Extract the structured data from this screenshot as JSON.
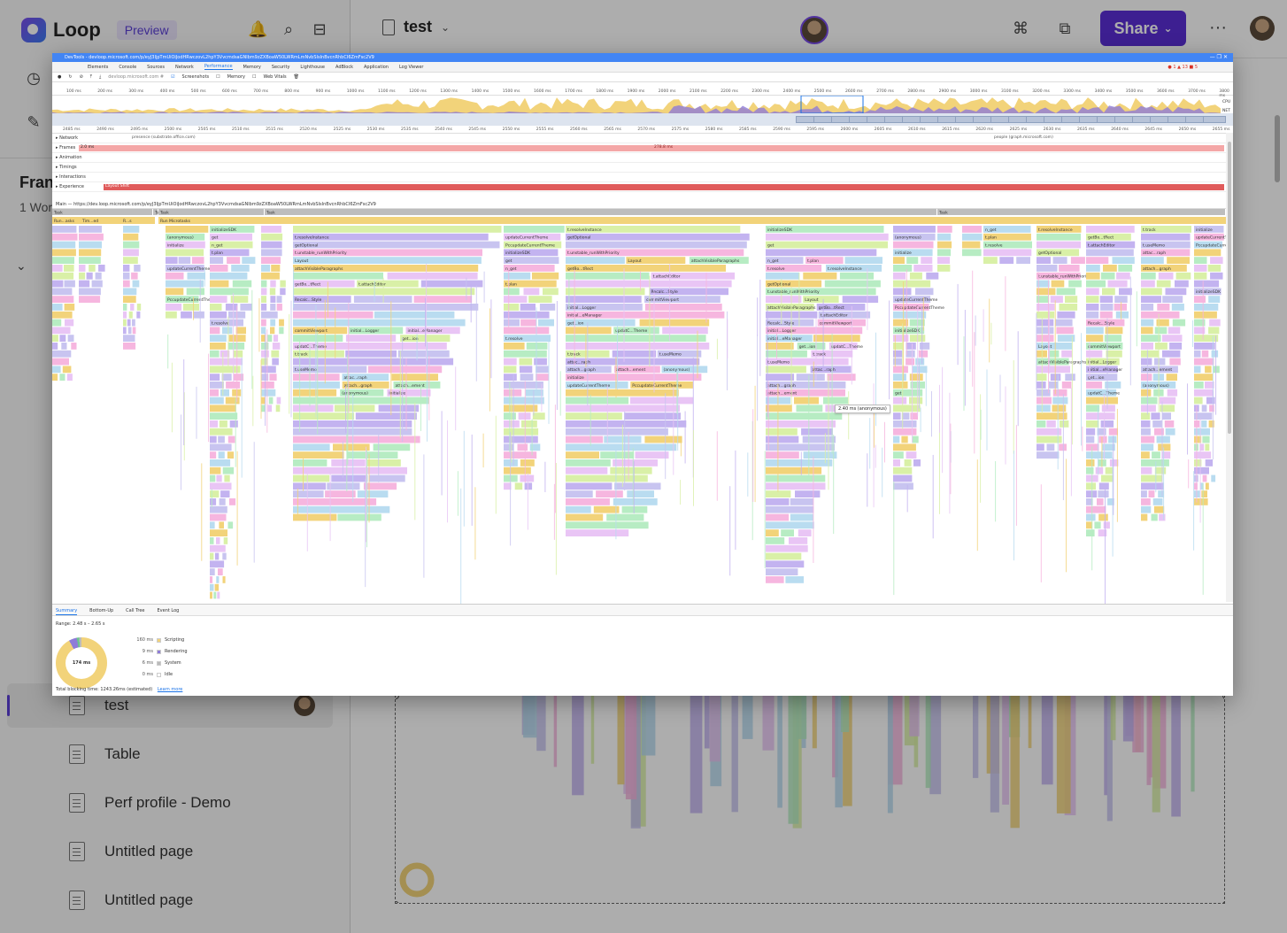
{
  "app": {
    "name": "Loop",
    "badge": "Preview",
    "doc_title": "test",
    "share_label": "Share",
    "more_label": "···"
  },
  "sidebar": {
    "workspace_title": "Fran",
    "workspace_sub": "1 Wor",
    "pages": [
      {
        "label": "test",
        "selected": true
      },
      {
        "label": "Table"
      },
      {
        "label": "Perf profile - Demo"
      },
      {
        "label": "Untitled page"
      },
      {
        "label": "Untitled page"
      }
    ]
  },
  "devtools": {
    "window_title": "DevTools - devloop.microsoft.com/p/eyJ3IjpTmUiOiJodHRwczovL2hpY3VvcmdsaGNlbm9zZXBoaW50LWRmLmNvbSIsInBvcnRhbCI6ZmFsc2V9",
    "window_controls": "— ❐ ✕",
    "tabs": [
      "Elements",
      "Console",
      "Sources",
      "Network",
      "Performance",
      "Memory",
      "Security",
      "Lighthouse",
      "AdBlock",
      "Application",
      "Log Viewer"
    ],
    "active_tab": "Performance",
    "issues": [
      "1",
      "13",
      "5"
    ],
    "toolbar": {
      "url": "devloop.microsoft.com #",
      "screenshots": "Screenshots",
      "memory": "Memory",
      "web_vitals": "Web Vitals"
    },
    "overview_ticks": [
      "100 ms",
      "200 ms",
      "300 ms",
      "400 ms",
      "500 ms",
      "600 ms",
      "700 ms",
      "800 ms",
      "900 ms",
      "1000 ms",
      "1100 ms",
      "1200 ms",
      "1300 ms",
      "1400 ms",
      "1500 ms",
      "1600 ms",
      "1700 ms",
      "1800 ms",
      "1900 ms",
      "2000 ms",
      "2100 ms",
      "2200 ms",
      "2300 ms",
      "2400 ms",
      "2500 ms",
      "2600 ms",
      "2700 ms",
      "2800 ms",
      "2900 ms",
      "3000 ms",
      "3100 ms",
      "3200 ms",
      "3300 ms",
      "3400 ms",
      "3500 ms",
      "3600 ms",
      "3700 ms",
      "3800 ms"
    ],
    "overview_labels": [
      "CPU",
      "NET"
    ],
    "detail_ticks": [
      "2485 ms",
      "2490 ms",
      "2495 ms",
      "2500 ms",
      "2505 ms",
      "2510 ms",
      "2515 ms",
      "2520 ms",
      "2525 ms",
      "2530 ms",
      "2535 ms",
      "2540 ms",
      "2545 ms",
      "2550 ms",
      "2555 ms",
      "2560 ms",
      "2565 ms",
      "2570 ms",
      "2575 ms",
      "2580 ms",
      "2585 ms",
      "2590 ms",
      "2595 ms",
      "2600 ms",
      "2605 ms",
      "2610 ms",
      "2615 ms",
      "2620 ms",
      "2625 ms",
      "2630 ms",
      "2635 ms",
      "2640 ms",
      "2645 ms",
      "2650 ms",
      "2655 ms"
    ],
    "tracks": [
      {
        "name": "Network",
        "note_left": "presence (substrate.office.com)",
        "note_right": "people (graph.microsoft.com)"
      },
      {
        "name": "Frames",
        "note_left": "2.0 ms",
        "note_center": "278.8 ms"
      },
      {
        "name": "Animation"
      },
      {
        "name": "Timings"
      },
      {
        "name": "Interactions"
      },
      {
        "name": "Experience",
        "note_left": "Layout Shift"
      }
    ],
    "main_label": "Main — https://dev.loop.microsoft.com/p/eyJ3IjpTmUiOiJodHRwczovL2hpY3VvcmdsaGNlbm9zZXBoaW50LWRmLmNvbSIsInBvcnRhbCI6ZmFsc2V9",
    "task_labels": [
      "Task",
      "Task",
      "Task",
      "Task",
      "Task"
    ],
    "flame_top": [
      "Run...asks",
      "Tim...ed",
      "R...s",
      "Run Microtasks"
    ],
    "flame_calls": [
      "(anonymous)",
      "initialize",
      "updateCurrentTheme",
      "PccupdateCurrentTheme",
      "initializeSDK",
      "get",
      "n_get",
      "t.plan",
      "t.resolve",
      "t.resolveInstance",
      "getOptional",
      "t.unstable_runWithPriority",
      "Layout",
      "attachVisibleParagraphs",
      "getBo...tRect",
      "t.attachEditor",
      "Recalc...Style",
      "commitViewport",
      "initial...Logger",
      "initial...eManager",
      "get...ion",
      "updatC...Theme",
      "t.track",
      "t.useMemo",
      "attac...raph",
      "attach...graph",
      "attach...ement"
    ],
    "tooltip": "2.40 ms (anonymous)",
    "bottom_tabs": [
      "Summary",
      "Bottom-Up",
      "Call Tree",
      "Event Log"
    ],
    "active_bottom_tab": "Summary",
    "summary": {
      "range": "Range: 2.48 s – 2.65 s",
      "total_ms": "174 ms",
      "items": [
        {
          "amount": "160 ms",
          "label": "Scripting",
          "color": "#f2d37a"
        },
        {
          "amount": "9 ms",
          "label": "Rendering",
          "color": "#8e7cd8"
        },
        {
          "amount": "6 ms",
          "label": "System",
          "color": "#bbbbbb"
        },
        {
          "amount": "0 ms",
          "label": "Idle",
          "color": "#ffffff"
        }
      ],
      "blocking": "Total blocking time: 1243.26ms (estimated)",
      "learn_more": "Learn more"
    }
  }
}
